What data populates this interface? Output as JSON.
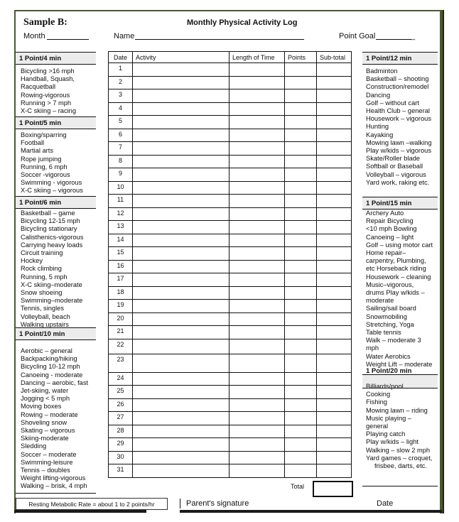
{
  "header": {
    "sample_label": "Sample B:",
    "title": "Monthly Physical Activity Log",
    "month_label": "Month",
    "name_label": "Name",
    "point_goal_label": "Point Goal",
    "point_goal_suffix": "_"
  },
  "left_column": [
    {
      "heading": "1 Point/4 min",
      "items": [
        "Bicycling >16 mph",
        "Handball, Squash,",
        "Racquetball",
        "Rowing-vigorous",
        "Running > 7 mph",
        "X-C skiing – racing"
      ]
    },
    {
      "heading": "1 Point/5 min",
      "items": [
        "Boxing/sparring",
        "Football",
        "Martial arts",
        "Rope jumping",
        "Running, 6 mph",
        "Soccer -vigorous",
        "Swimming - vigorous",
        "X-C skiing – vigorous"
      ]
    },
    {
      "heading": "1 Point/6 min",
      "items": [
        "Basketball – game",
        "Bicycling 12-15 mph",
        "Bicycling stationary",
        "Calisthenics-vigorous",
        "Carrying heavy loads",
        "Circuit training",
        "Hockey",
        "Rock climbing",
        "Running, 5 mph",
        "X-C skiing–moderate",
        "Snow shoeing",
        "Swimming–moderate",
        "Tennis, singles",
        "Volleyball, beach",
        "Walking upstairs"
      ]
    },
    {
      "heading": "1 Point/10 min",
      "items": [
        "Aerobic – general",
        "Backpacking/hiking",
        "Bicycling 10-12 mph",
        "Canoeing - moderate",
        "Dancing – aerobic, fast",
        "Jet-skiing, water",
        "Jogging < 5 mph",
        "Moving boxes",
        "Rowing – moderate",
        "Shoveling snow",
        "Skating – vigorous",
        "Skiing-moderate",
        "Sledding",
        "Soccer – moderate",
        "Swimming-leisure",
        "Tennis – doubles",
        "Weight lifting-vigorous",
        "Walking – brisk, 4 mph"
      ]
    }
  ],
  "right_column": [
    {
      "heading": "1 Point/12 min",
      "items": [
        "Badminton",
        "Basketball – shooting",
        "Construction/remodel",
        "Dancing",
        "Golf – without cart",
        "Health Club – general",
        "Housework – vigorous",
        "Hunting",
        "Kayaking",
        "Mowing lawn –walking",
        "Play w/kids – vigorous",
        "Skate/Roller blade",
        "Softball or Baseball",
        "Volleyball – vigorous",
        "Yard work, raking etc."
      ]
    },
    {
      "heading": "1 Point/15 min",
      "items": [
        "Archery Auto",
        "Repair Bicycling",
        "<10 mph Bowling",
        "Canoeing – light",
        "Golf – using motor cart",
        "Home repair–",
        "carpentry, Plumbing,",
        "etc Horseback riding",
        "Housework – cleaning",
        "Music–vigorous,",
        "drums Play w/kids –",
        "moderate",
        "Sailing/sail board",
        "Snowmobiling",
        "Stretching, Yoga",
        "Table tennis",
        "Walk – moderate 3",
        "mph",
        "Water Aerobics",
        "Weight Lift – moderate"
      ]
    },
    {
      "heading": "1 Point/20 min",
      "items": [
        "Billiards/pool",
        "Cooking",
        "Fishing",
        "Mowing lawn – riding",
        "Music playing –",
        "general",
        "Playing catch",
        "Play w/kids – light",
        "Walking – slow 2 mph",
        "Yard games – croquet,",
        "frisbee, darts, etc."
      ]
    }
  ],
  "log_table": {
    "columns": [
      "Date",
      "Activity",
      "Length of Time",
      "Points",
      "Sub-total"
    ],
    "dates": [
      "1",
      "2",
      "3",
      "4",
      "5",
      "6",
      "7",
      "8",
      "9",
      "10",
      "11",
      "12",
      "13",
      "14",
      "15",
      "16",
      "17",
      "18",
      "19",
      "20",
      "21",
      "22",
      "23",
      "24",
      "25",
      "26",
      "27",
      "28",
      "29",
      "30",
      "31"
    ],
    "total_label": "Total"
  },
  "footer": {
    "rmr_note": "Resting Metabolic Rate = about 1 to 2 points/hr",
    "parent_signature_label": "Parent's signature",
    "date_label": "Date"
  }
}
